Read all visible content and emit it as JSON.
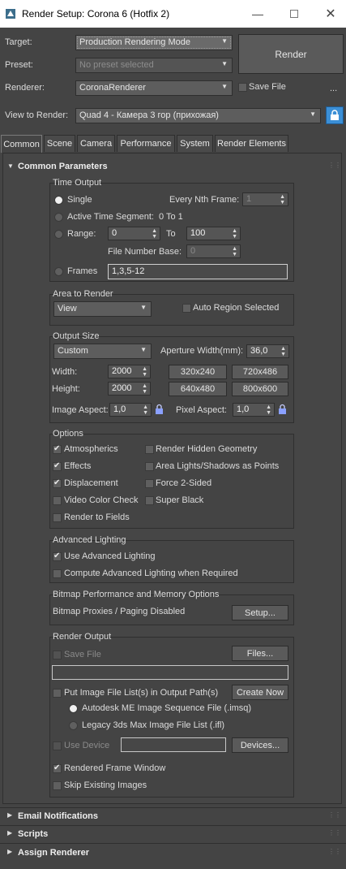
{
  "window": {
    "title": "Render Setup: Corona 6 (Hotfix 2)"
  },
  "top": {
    "target_label": "Target:",
    "target_value": "Production Rendering Mode",
    "preset_label": "Preset:",
    "preset_value": "No preset selected",
    "renderer_label": "Renderer:",
    "renderer_value": "CoronaRenderer",
    "save_file_label": "Save File",
    "more_label": "...",
    "view_label": "View to Render:",
    "view_value": "Quad 4 - Камера 3 гор (прихожая)",
    "render_button": "Render"
  },
  "tabs": [
    "Common",
    "Scene",
    "Camera",
    "Performance",
    "System",
    "Render Elements"
  ],
  "common": {
    "header": "Common Parameters",
    "time_output": {
      "title": "Time Output",
      "single": "Single",
      "every_nth_label": "Every Nth Frame:",
      "every_nth_value": "1",
      "active_segment": "Active Time Segment:",
      "active_segment_value": "0 To 1",
      "range": "Range:",
      "range_from": "0",
      "to_label": "To",
      "range_to": "100",
      "file_number_base_label": "File Number Base:",
      "file_number_base_value": "0",
      "frames": "Frames",
      "frames_value": "1,3,5-12"
    },
    "area": {
      "title": "Area to Render",
      "value": "View",
      "auto_region": "Auto Region Selected"
    },
    "output_size": {
      "title": "Output Size",
      "preset": "Custom",
      "aperture_label": "Aperture Width(mm):",
      "aperture_value": "36,0",
      "width_label": "Width:",
      "width_value": "2000",
      "height_label": "Height:",
      "height_value": "2000",
      "presets": [
        "320x240",
        "720x486",
        "640x480",
        "800x600"
      ],
      "image_aspect_label": "Image Aspect:",
      "image_aspect_value": "1,0",
      "pixel_aspect_label": "Pixel Aspect:",
      "pixel_aspect_value": "1,0"
    },
    "options": {
      "title": "Options",
      "left": [
        {
          "label": "Atmospherics",
          "checked": true
        },
        {
          "label": "Effects",
          "checked": true
        },
        {
          "label": "Displacement",
          "checked": true
        },
        {
          "label": "Video Color Check",
          "checked": false
        },
        {
          "label": "Render to Fields",
          "checked": false
        }
      ],
      "right": [
        {
          "label": "Render Hidden Geometry",
          "checked": false
        },
        {
          "label": "Area Lights/Shadows as Points",
          "checked": false
        },
        {
          "label": "Force 2-Sided",
          "checked": false
        },
        {
          "label": "Super Black",
          "checked": false
        }
      ]
    },
    "advanced_lighting": {
      "title": "Advanced Lighting",
      "use": "Use Advanced Lighting",
      "compute": "Compute Advanced Lighting when Required"
    },
    "bitmap": {
      "title": "Bitmap Performance and Memory Options",
      "status": "Bitmap Proxies / Paging Disabled",
      "setup": "Setup..."
    },
    "render_output": {
      "title": "Render Output",
      "save_file": "Save File",
      "files": "Files...",
      "put_image": "Put Image File List(s) in Output Path(s)",
      "create_now": "Create Now",
      "autodesk_me": "Autodesk ME Image Sequence File (.imsq)",
      "legacy": "Legacy 3ds Max Image File List (.ifl)",
      "use_device": "Use Device",
      "devices": "Devices...",
      "rendered_frame": "Rendered Frame Window",
      "skip_existing": "Skip Existing Images"
    }
  },
  "rollouts": [
    "Email Notifications",
    "Scripts",
    "Assign Renderer"
  ]
}
